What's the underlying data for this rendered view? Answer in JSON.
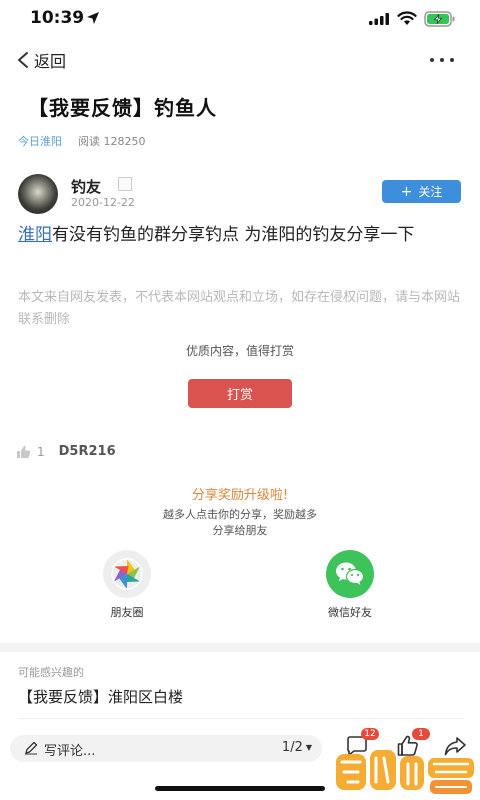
{
  "status_bar": {
    "time": "10:39"
  },
  "nav": {
    "back_label": "返回"
  },
  "article": {
    "title": "【我要反馈】钓鱼人",
    "source": "今日淮阳",
    "reads": "阅读 128250"
  },
  "author": {
    "name": "钓友",
    "date": "2020-12-22",
    "follow_label": "关注",
    "follow_color": "#3d8fdc"
  },
  "content": {
    "link_text": "淮阳",
    "body_text": "有没有钓鱼的群分享钓点  为淮阳的钓友分享一下"
  },
  "disclaimer": "本文来自网友发表，不代表本网站观点和立场，如存在侵权问题，请与本网站联系删除",
  "reward": {
    "quality_text": "优质内容，值得打赏",
    "button_label": "打赏",
    "button_color": "#d9534f"
  },
  "likes": {
    "count": "1",
    "user": "D5R216"
  },
  "share": {
    "title": "分享奖励升级啦!",
    "subtitle_line1": "越多人点击你的分享，奖励越多",
    "subtitle_line2": "分享给朋友",
    "moments_label": "朋友圈",
    "wechat_label": "微信好友",
    "title_color": "#d9873a",
    "wechat_color": "#3ec35b"
  },
  "related": {
    "heading": "可能感兴趣的",
    "items": [
      {
        "title": "【我要反馈】淮阳区白楼"
      }
    ]
  },
  "bottom_bar": {
    "comment_placeholder": "写评论...",
    "page_indicator": "1/2",
    "comment_count": "12",
    "like_count": "1"
  },
  "icons": {
    "location": "location-arrow-icon",
    "signal": "cellular-signal-icon",
    "wifi": "wifi-icon",
    "battery": "battery-charging-icon",
    "back": "chevron-left-icon",
    "more": "more-dots-icon",
    "thumb": "thumbs-up-icon",
    "moments": "moments-aperture-icon",
    "wechat": "wechat-icon",
    "pencil": "pencil-icon",
    "comment": "comment-icon",
    "share": "share-arrow-icon"
  }
}
